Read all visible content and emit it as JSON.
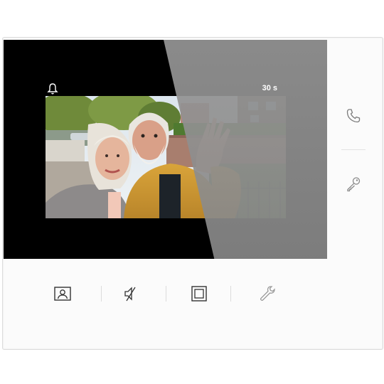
{
  "status": {
    "timer": "30 s"
  },
  "icons": {
    "bell": "bell-icon",
    "phone": "phone-icon",
    "key": "key-icon",
    "contacts": "contact-card-icon",
    "mute": "speaker-mute-icon",
    "screen": "square-screen-icon",
    "settings": "wrench-icon"
  },
  "colors": {
    "screen_background": "#000000",
    "device_body": "#fbfbfb",
    "icon_primary": "#333333",
    "icon_muted": "#9a9a9a"
  }
}
